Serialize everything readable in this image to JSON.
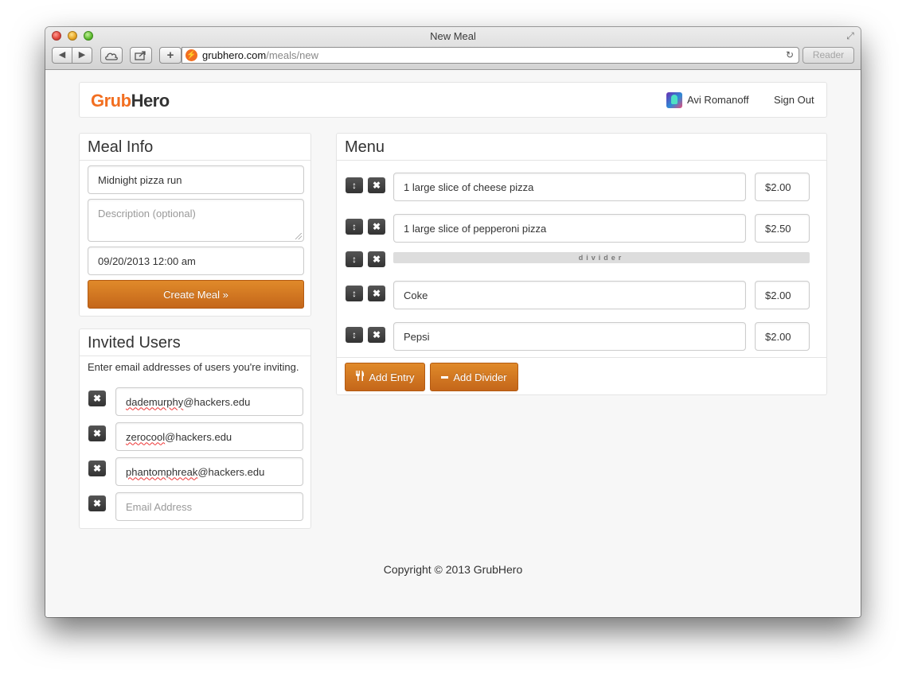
{
  "window": {
    "title": "New Meal"
  },
  "browser": {
    "url_host": "grubhero.com",
    "url_path": "/meals/new",
    "reader_label": "Reader"
  },
  "navbar": {
    "brand_part1": "Grub",
    "brand_part2": "Hero",
    "user_name": "Avi Romanoff",
    "signout_label": "Sign Out"
  },
  "meal_info": {
    "title": "Meal Info",
    "name_value": "Midnight pizza run",
    "description_placeholder": "Description (optional)",
    "datetime_value": "09/20/2013 12:00 am",
    "create_label": "Create Meal »"
  },
  "invited_users": {
    "title": "Invited Users",
    "help_text": "Enter email addresses of users you're inviting.",
    "emails": [
      {
        "user": "dademurphy",
        "domain": "@hackers.edu"
      },
      {
        "user": "zerocool",
        "domain": "@hackers.edu"
      },
      {
        "user": "phantomphreak",
        "domain": "@hackers.edu"
      }
    ],
    "new_email_placeholder": "Email Address"
  },
  "menu": {
    "title": "Menu",
    "entries": [
      {
        "name": "1 large slice of cheese pizza",
        "price": "$2.00"
      },
      {
        "name": "1 large slice of pepperoni pizza",
        "price": "$2.50"
      },
      {
        "name": "Coke",
        "price": "$2.00"
      },
      {
        "name": "Pepsi",
        "price": "$2.00"
      }
    ],
    "divider_label": "divider",
    "add_entry_label": "Add Entry",
    "add_divider_label": "Add Divider"
  },
  "footer": {
    "copyright": "Copyright © 2013 GrubHero"
  },
  "icons": {
    "move": "↕",
    "remove": "✖",
    "fork_knife": "🍴",
    "minus": "—"
  },
  "colors": {
    "brand_orange": "#f26f21",
    "button_orange": "#d47820",
    "dark_button": "#444444"
  }
}
